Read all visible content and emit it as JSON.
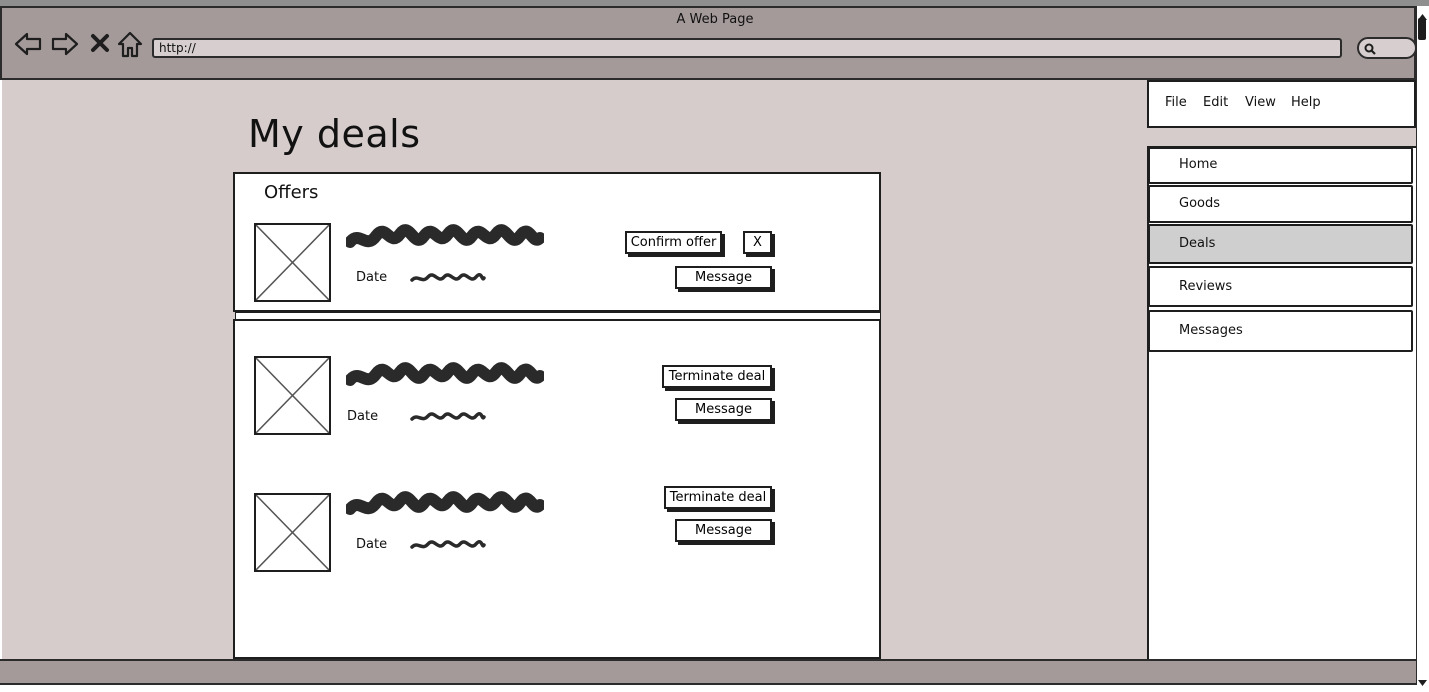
{
  "browser": {
    "window_title": "A Web Page",
    "url": "http://",
    "nav_icons": [
      "back-arrow-icon",
      "forward-arrow-icon",
      "stop-x-icon",
      "home-icon"
    ],
    "search_icon": "magnifier-icon"
  },
  "page": {
    "title": "My deals",
    "offers_heading": "Offers",
    "date_label": "Date"
  },
  "offers": [
    {
      "date_label": "Date",
      "actions": {
        "confirm_label": "Confirm offer",
        "reject_label": "X",
        "message_label": "Message"
      }
    }
  ],
  "deals": [
    {
      "date_label": "Date",
      "actions": {
        "terminate_label": "Terminate deal",
        "message_label": "Message"
      }
    },
    {
      "date_label": "Date",
      "actions": {
        "terminate_label": "Terminate deal",
        "message_label": "Message"
      }
    }
  ],
  "menubar": {
    "items": [
      {
        "label": "File"
      },
      {
        "label": "Edit"
      },
      {
        "label": "View"
      },
      {
        "label": "Help"
      }
    ]
  },
  "sidenav": {
    "items": [
      {
        "label": "Home",
        "active": false
      },
      {
        "label": "Goods",
        "active": false
      },
      {
        "label": "Deals",
        "active": true
      },
      {
        "label": "Reviews",
        "active": false
      },
      {
        "label": "Messages",
        "active": false
      }
    ]
  },
  "colors": {
    "chrome": "#a59a9a",
    "content_bg": "#d6cccc",
    "active_nav": "#cfcfcf",
    "ink": "#1e1e1e"
  }
}
